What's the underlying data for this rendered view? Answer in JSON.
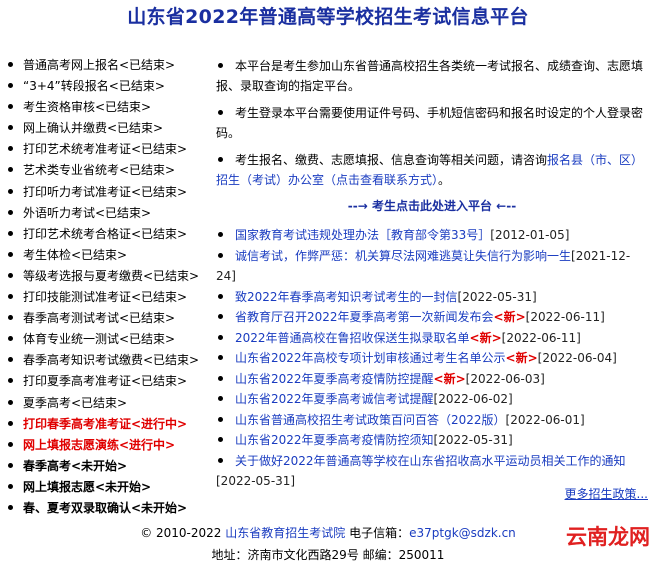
{
  "page": {
    "title": "山东省2022年普通高等学校招生考试信息平台"
  },
  "left_menu": [
    {
      "label": "普通高考网上报名<已结束>",
      "style": "normal"
    },
    {
      "label": "“3+4”转段报名<已结束>",
      "style": "normal"
    },
    {
      "label": "考生资格审核<已结束>",
      "style": "normal"
    },
    {
      "label": "网上确认并缴费<已结束>",
      "style": "normal"
    },
    {
      "label": "打印艺术统考准考证<已结束>",
      "style": "normal"
    },
    {
      "label": "艺术类专业省统考<已结束>",
      "style": "normal"
    },
    {
      "label": "打印听力考试准考证<已结束>",
      "style": "normal"
    },
    {
      "label": "外语听力考试<已结束>",
      "style": "normal"
    },
    {
      "label": "打印艺术统考合格证<已结束>",
      "style": "normal"
    },
    {
      "label": "考生体检<已结束>",
      "style": "normal"
    },
    {
      "label": "等级考选报与夏考缴费<已结束>",
      "style": "normal"
    },
    {
      "label": "打印技能测试准考证<已结束>",
      "style": "normal"
    },
    {
      "label": "春季高考测试考试<已结束>",
      "style": "normal"
    },
    {
      "label": "体育专业统一测试<已结束>",
      "style": "normal"
    },
    {
      "label": "春季高考知识考试缴费<已结束>",
      "style": "normal"
    },
    {
      "label": "打印夏季高考准考证<已结束>",
      "style": "normal"
    },
    {
      "label": "夏季高考<已结束>",
      "style": "normal"
    },
    {
      "label": "打印春季高考准考证<进行中>",
      "style": "red"
    },
    {
      "label": "网上填报志愿演练<进行中>",
      "style": "red"
    },
    {
      "label": "春季高考<未开始>",
      "style": "bold"
    },
    {
      "label": "网上填报志愿<未开始>",
      "style": "bold"
    },
    {
      "label": "春、夏考双录取确认<未开始>",
      "style": "bold"
    }
  ],
  "intro": {
    "p1": "本平台是考生参加山东省普通高校招生各类统一考试报名、成绩查询、志愿填报、录取查询的指定平台。",
    "p2": "考生登录本平台需要使用证件号码、手机短信密码和报名时设定的个人登录密码。",
    "p3_prefix": "考生报名、缴费、志愿填报、信息查询等相关问题，请咨询",
    "p3_link": "报名县（市、区）招生（考试）办公室（点击查看联系方式）",
    "p3_suffix": "。"
  },
  "enter_link": "--→ 考生点击此处进入平台 ←--",
  "news": [
    {
      "title": "国家教育考试违规处理办法［教育部令第33号］",
      "new": "",
      "date": "[2012-01-05]"
    },
    {
      "title": "诚信考试，作弊严惩：机关算尽法网难逃莫让失信行为影响一生",
      "new": "",
      "date": "[2021-12-24]"
    },
    {
      "title": "致2022年春季高考知识考试考生的一封信",
      "new": "",
      "date": "[2022-05-31]"
    },
    {
      "title": "省教育厅召开2022年夏季高考第一次新闻发布会",
      "new": "<新>",
      "date": "[2022-06-11]"
    },
    {
      "title": "2022年普通高校在鲁招收保送生拟录取名单",
      "new": "<新>",
      "date": "[2022-06-11]"
    },
    {
      "title": "山东省2022年高校专项计划审核通过考生名单公示",
      "new": "<新>",
      "date": "[2022-06-04]"
    },
    {
      "title": "山东省2022年夏季高考疫情防控提醒",
      "new": "<新>",
      "date": "[2022-06-03]"
    },
    {
      "title": "山东省2022年夏季高考诚信考试提醒",
      "new": "",
      "date": "[2022-06-02]"
    },
    {
      "title": "山东省普通高校招生考试政策百问百答（2022版）",
      "new": "",
      "date": "[2022-06-01]"
    },
    {
      "title": "山东省2022年夏季高考疫情防控须知",
      "new": "",
      "date": "[2022-05-31]"
    },
    {
      "title": "关于做好2022年普通高等学校在山东省招收高水平运动员相关工作的通知",
      "new": "",
      "date": "[2022-05-31]"
    }
  ],
  "more_link": "更多招生政策...",
  "footer": {
    "copyright": "© 2010-2022",
    "org_link": "山东省教育招生考试院",
    "email_label": "电子信箱：",
    "email": "e37ptgk@sdzk.cn",
    "address": "地址：济南市文化西路29号 邮编：250011"
  },
  "watermark": "云南龙网",
  "colors": {
    "title": "#1a2fa0",
    "link": "#1a3cc0",
    "active": "#e00000"
  }
}
